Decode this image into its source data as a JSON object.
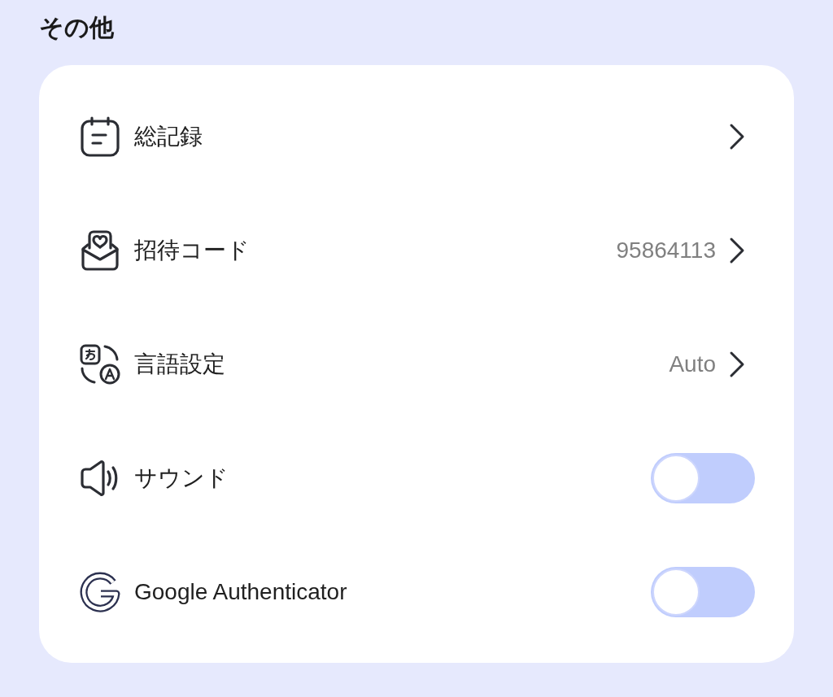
{
  "section": {
    "title": "その他"
  },
  "items": [
    {
      "kind": "link",
      "label": "総記録"
    },
    {
      "kind": "link",
      "label": "招待コード",
      "value": "95864113"
    },
    {
      "kind": "link",
      "label": "言語設定",
      "value": "Auto"
    },
    {
      "kind": "toggle",
      "label": "サウンド",
      "on": false
    },
    {
      "kind": "toggle",
      "label": "Google Authenticator",
      "on": false
    }
  ]
}
